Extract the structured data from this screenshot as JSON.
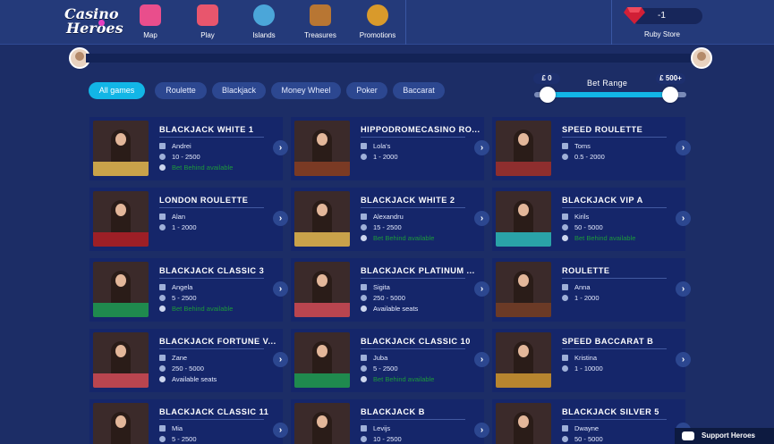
{
  "brand": {
    "logo_line1": "Casino",
    "logo_line2": "Heroes"
  },
  "nav": [
    {
      "label": "Map",
      "icon": "map-icon",
      "color": "#e94e8c"
    },
    {
      "label": "Play",
      "icon": "slot-machine-icon",
      "color": "#e8566d"
    },
    {
      "label": "Islands",
      "icon": "globe-icon",
      "color": "#4ba6d9"
    },
    {
      "label": "Treasures",
      "icon": "treasure-chest-icon",
      "color": "#b87633"
    },
    {
      "label": "Promotions",
      "icon": "gold-coin-icon",
      "color": "#d99a2b"
    }
  ],
  "ruby": {
    "balance": "-1",
    "store_label": "Ruby Store",
    "color": "#d11f36"
  },
  "filters": {
    "items": [
      "All games",
      "Roulette",
      "Blackjack",
      "Money Wheel",
      "Poker",
      "Baccarat"
    ],
    "active_index": 0
  },
  "bet_range": {
    "label": "Bet Range",
    "min_label": "£ 0",
    "max_label": "£ 500+"
  },
  "games": [
    {
      "title": "BLACKJACK WHITE 1",
      "dealer": "Andrei",
      "limits": "10 - 2500",
      "extra": "Bet Behind available",
      "extra_type": "bet-behind",
      "felt": "#c9a24a"
    },
    {
      "title": "HIPPODROMECASINO RO...",
      "dealer": "Lola's",
      "limits": "1 - 2000",
      "extra": "",
      "extra_type": "",
      "felt": "#7a3a24"
    },
    {
      "title": "SPEED ROULETTE",
      "dealer": "Toms",
      "limits": "0.5 - 2000",
      "extra": "",
      "extra_type": "",
      "felt": "#8e2e2e"
    },
    {
      "title": "LONDON ROULETTE",
      "dealer": "Alan",
      "limits": "1 - 2000",
      "extra": "",
      "extra_type": "",
      "felt": "#9d1f26"
    },
    {
      "title": "BLACKJACK WHITE 2",
      "dealer": "Alexandru",
      "limits": "15 - 2500",
      "extra": "Bet Behind available",
      "extra_type": "bet-behind",
      "felt": "#c9a24a"
    },
    {
      "title": "BLACKJACK VIP A",
      "dealer": "Kirils",
      "limits": "50 - 5000",
      "extra": "Bet Behind available",
      "extra_type": "bet-behind",
      "felt": "#2aa3a8"
    },
    {
      "title": "BLACKJACK CLASSIC 3",
      "dealer": "Angela",
      "limits": "5 - 2500",
      "extra": "Bet Behind available",
      "extra_type": "bet-behind",
      "felt": "#1f8a4e"
    },
    {
      "title": "BLACKJACK PLATINUM ...",
      "dealer": "Sigita",
      "limits": "250 - 5000",
      "extra": "Available seats",
      "extra_type": "seats",
      "felt": "#b9454f"
    },
    {
      "title": "ROULETTE",
      "dealer": "Anna",
      "limits": "1 - 2000",
      "extra": "",
      "extra_type": "",
      "felt": "#6b3a26"
    },
    {
      "title": "BLACKJACK FORTUNE V...",
      "dealer": "Zane",
      "limits": "250 - 5000",
      "extra": "Available seats",
      "extra_type": "seats",
      "felt": "#b9454f"
    },
    {
      "title": "BLACKJACK CLASSIC 10",
      "dealer": "Juba",
      "limits": "5 - 2500",
      "extra": "Bet Behind available",
      "extra_type": "bet-behind",
      "felt": "#1f8a4e"
    },
    {
      "title": "SPEED BACCARAT B",
      "dealer": "Kristina",
      "limits": "1 - 10000",
      "extra": "",
      "extra_type": "",
      "felt": "#b7852f"
    },
    {
      "title": "BLACKJACK CLASSIC 11",
      "dealer": "Mia",
      "limits": "5 - 2500",
      "extra": "",
      "extra_type": "",
      "felt": "#1f8a4e"
    },
    {
      "title": "BLACKJACK B",
      "dealer": "Levijs",
      "limits": "10 - 2500",
      "extra": "",
      "extra_type": "",
      "felt": "#c9a24a"
    },
    {
      "title": "BLACKJACK SILVER 5",
      "dealer": "Dwayne",
      "limits": "50 - 5000",
      "extra": "",
      "extra_type": "",
      "felt": "#2aa3a8"
    }
  ],
  "support": {
    "label": "Support Heroes"
  }
}
